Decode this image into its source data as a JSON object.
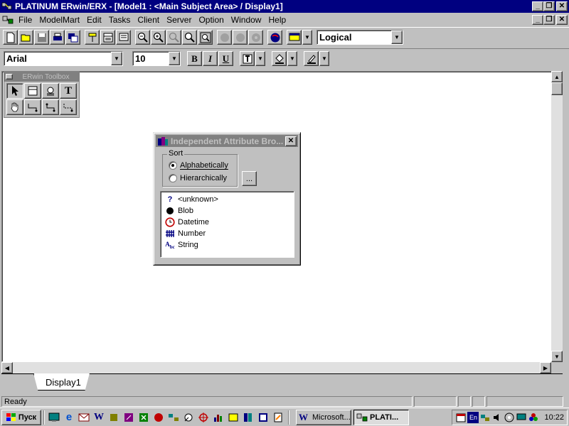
{
  "window": {
    "title": "PLATINUM ERwin/ERX - [Model1 : <Main Subject Area> / Display1]",
    "caption_buttons": [
      "_",
      "❐",
      "✕"
    ]
  },
  "menubar": {
    "items": [
      {
        "label": "File"
      },
      {
        "label": "ModelMart"
      },
      {
        "label": "Edit"
      },
      {
        "label": "Tasks"
      },
      {
        "label": "Client"
      },
      {
        "label": "Server"
      },
      {
        "label": "Option"
      },
      {
        "label": "Window"
      },
      {
        "label": "Help"
      }
    ]
  },
  "toolbar1": {
    "view_level": "Logical"
  },
  "toolbar2": {
    "font_name": "Arial",
    "font_size": "10",
    "bold_label": "B",
    "italic_label": "I",
    "underline_label": "U"
  },
  "toolbox": {
    "title": "ERwin Toolbox"
  },
  "tabs": [
    {
      "label": "Display1",
      "active": true
    }
  ],
  "dialog": {
    "title": "Independent Attribute Bro...",
    "sort_label": "Sort",
    "options": [
      {
        "label": "Alphabetically",
        "checked": true
      },
      {
        "label": "Hierarchically",
        "checked": false
      }
    ],
    "ellipsis_label": "...",
    "attributes": [
      {
        "icon": "question-icon",
        "label": "<unknown>"
      },
      {
        "icon": "blob-icon",
        "label": "Blob"
      },
      {
        "icon": "clock-icon",
        "label": "Datetime"
      },
      {
        "icon": "number-icon",
        "label": "Number"
      },
      {
        "icon": "string-icon",
        "label": "String"
      }
    ]
  },
  "statusbar": {
    "text": "Ready"
  },
  "taskbar": {
    "start_label": "Пуск",
    "tasks": [
      {
        "label": "Microsoft...",
        "active": false
      },
      {
        "label": "PLATI...",
        "active": true
      }
    ],
    "tray_lang": "En",
    "clock": "10:22"
  },
  "colors": {
    "titlebar_active": "#000080",
    "titlebar_inactive": "#808080",
    "face": "#c0c0c0",
    "canvas": "#ffffff"
  }
}
